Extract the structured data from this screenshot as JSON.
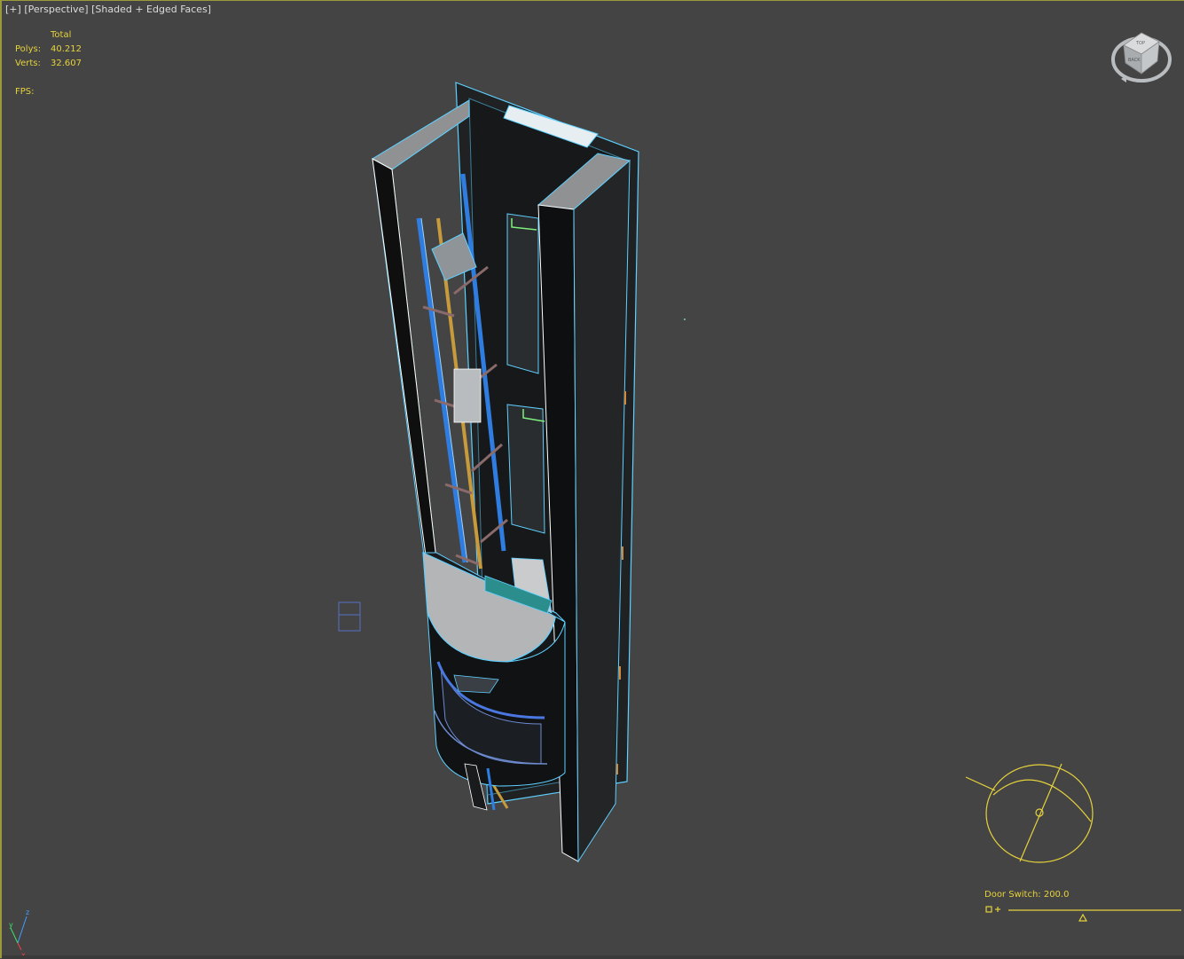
{
  "viewport": {
    "label_plus": "[+]",
    "label_view": "[Perspective]",
    "label_shading": "[Shaded + Edged Faces]",
    "accent_color": "#e6d23c",
    "background_color": "#444444"
  },
  "stats": {
    "header": "Total",
    "polys_label": "Polys:",
    "polys_value": "40.212",
    "verts_label": "Verts:",
    "verts_value": "32.607",
    "fps_label": "FPS:"
  },
  "viewcube": {
    "icon": "viewcube-icon",
    "face_top": "TOP",
    "face_back": "BACK"
  },
  "manipulator": {
    "label": "Door Switch: 200.0",
    "slider_value": 200.0,
    "icon": "slider-manipulator-icon"
  },
  "axis_tripod": {
    "x": "x",
    "y": "y",
    "z": "z"
  },
  "scene": {
    "object": "elevator-shaft-model",
    "wire_color": "#5fd0ff"
  }
}
